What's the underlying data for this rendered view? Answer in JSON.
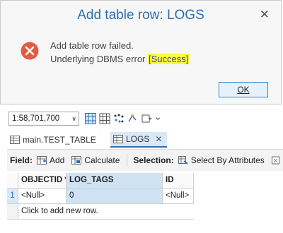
{
  "dialog": {
    "title": "Add table row: LOGS",
    "close": "✕",
    "message_line1": "Add table row failed.",
    "message_line2_prefix": "Underlying DBMS error ",
    "message_line2_highlight": "[Success]",
    "ok_label": "OK",
    "error_icon": "error-circle-x-icon",
    "error_color": "#e05c43"
  },
  "toolbar": {
    "scale_value": "1:58,701,700",
    "scale_arrow": "∨"
  },
  "tabs": [
    {
      "label": "main.TEST_TABLE",
      "active": false
    },
    {
      "label": "LOGS",
      "active": true,
      "close": "✕"
    }
  ],
  "fieldbar": {
    "field_label": "Field:",
    "add_label": "Add",
    "calculate_label": "Calculate",
    "selection_label": "Selection:",
    "select_by_attr_label": "Select By Attributes",
    "more_label": "Z"
  },
  "table": {
    "columns": [
      "OBJECTID *",
      "LOG_TAGS",
      "ID"
    ],
    "rows": [
      {
        "num": "1",
        "cells": [
          "<Null>",
          "0",
          "<Null>"
        ]
      }
    ],
    "add_row_text": "Click to add new row."
  },
  "colors": {
    "accent": "#2b6fb3",
    "highlight": "#fffa3c",
    "selected": "#cfe3f5"
  }
}
